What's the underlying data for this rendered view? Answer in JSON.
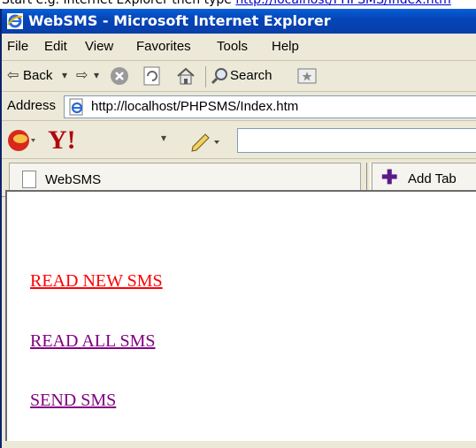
{
  "caption": {
    "prefix": "Start e.g. Internet Explorer then type ",
    "link": "http://localhost/PHPSMS/Index.htm"
  },
  "window": {
    "title": "WebSMS - Microsoft Internet Explorer"
  },
  "menu": [
    "File",
    "Edit",
    "View",
    "Favorites",
    "Tools",
    "Help"
  ],
  "toolbar": {
    "back_label": "Back",
    "search_label": "Search"
  },
  "address": {
    "label": "Address",
    "url": "http://localhost/PHPSMS/Index.htm"
  },
  "tabs": {
    "active_label": "WebSMS",
    "add_tab_label": "Add Tab"
  },
  "content": {
    "links": [
      "READ  NEW SMS",
      "READ ALL SMS",
      "SEND SMS"
    ]
  },
  "colors": {
    "unvisited_link": "#ff0000",
    "visited_link": "#800080",
    "titlebar": "#0a4fc8"
  },
  "icons": [
    "ie-app-icon",
    "back-arrow-icon",
    "forward-arrow-icon",
    "stop-icon",
    "refresh-icon",
    "home-icon",
    "search-icon",
    "favorites-icon",
    "ie-page-icon",
    "yahoo-messenger-icon",
    "yahoo-logo",
    "pencil-icon",
    "page-icon",
    "plus-icon"
  ]
}
